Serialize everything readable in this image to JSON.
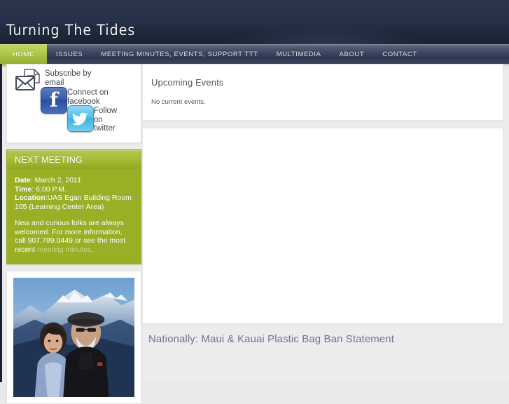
{
  "site": {
    "title": "Turning The Tides"
  },
  "nav": {
    "items": [
      {
        "label": "HOME",
        "active": true
      },
      {
        "label": "ISSUES",
        "active": false
      },
      {
        "label": "Meeting Minutes, Events, Support TTT",
        "active": false
      },
      {
        "label": "MULTIMEDIA",
        "active": false
      },
      {
        "label": "ABOUT",
        "active": false
      },
      {
        "label": "CONTACT",
        "active": false
      }
    ]
  },
  "sidebar": {
    "social": {
      "email": {
        "label": "Subscribe by email",
        "icon": "envelope-icon"
      },
      "facebook": {
        "label": "Connect on facebook",
        "icon": "facebook-icon",
        "glyph": "f",
        "color": "#3b5ca8"
      },
      "twitter": {
        "label": "Follow on twitter",
        "icon": "twitter-icon",
        "glyph": "t",
        "color": "#3ab3e2"
      }
    },
    "meeting": {
      "heading": "NEXT MEETING",
      "date_label": "Date",
      "date_value": ": March 2, 2011",
      "time_label": "Time",
      "time_value": ": 6:00 P.M.",
      "location_label": "Location",
      "location_value": ":UAS Egan Building Room 105 (Learning Center Area)",
      "note_before": "New and curious folks are always welcomed. For more information, call 907.789.0449 or see the most recent ",
      "note_link": "meeting minutes",
      "note_after": ".",
      "accent_color": "#9aae26"
    },
    "photo": {
      "alt": "Two people standing in front of snow-capped mountains"
    }
  },
  "main": {
    "events_panel": {
      "title": "Upcoming Events",
      "body": "No current events."
    },
    "post": {
      "title": "Nationally: Maui & Kauai Plastic Bag Ban Statement",
      "link_color": "#6d7492"
    }
  }
}
